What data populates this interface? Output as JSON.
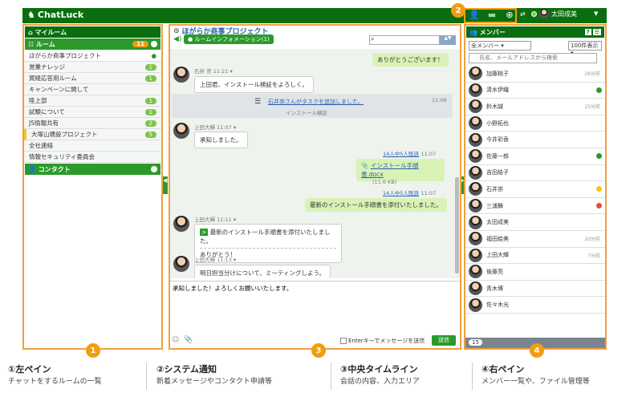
{
  "app": {
    "name": "ChatLuck",
    "user": "太田成美"
  },
  "left": {
    "my_room": "マイルーム",
    "rooms_header": "ルーム",
    "rooms_badge": "11",
    "rooms": [
      {
        "name": "ほがらか商事プロジェクト",
        "badge": ""
      },
      {
        "name": "営業ナレッジ",
        "badge": "1"
      },
      {
        "name": "貿経応答用ルーム",
        "badge": "1"
      },
      {
        "name": "キャンペーンに関して",
        "badge": ""
      },
      {
        "name": "陸上部",
        "badge": "1"
      },
      {
        "name": "試験について",
        "badge": "1"
      },
      {
        "name": "JS情報共有",
        "badge": "2"
      },
      {
        "name": "大塚山建設プロジェクト",
        "badge": "5"
      },
      {
        "name": "全社連絡",
        "badge": ""
      },
      {
        "name": "情報セキュリティ委員会",
        "badge": ""
      }
    ],
    "contacts": "コンタクト"
  },
  "center": {
    "room_title": "ほがらか商事プロジェクト",
    "room_info": "ルームインフォメーション(1)",
    "search_placeholder": "",
    "messages": {
      "m1": "ありがとうございます！",
      "m2_name": "石井 崇",
      "m2_time": "11:21",
      "m2_text": "上田君、インストール検証をよろしく。",
      "task_text": "石井崇さんがタスクを追加しました。",
      "task_sub": "インストール検証",
      "task_time": "11:06",
      "m3_name": "上田大輝",
      "m3_time": "11:07",
      "m3_text": "承知しました。",
      "read1": "14人中5人既読",
      "read1_time": "11:07",
      "file_name": "インストール手順書.docx",
      "file_size": "(11.6 KB)",
      "read2": "14人中5人既読",
      "read2_time": "11:07",
      "m4_text": "最新のインストール手順書を添付いたしました。",
      "m5_name": "上田大輝",
      "m5_time": "11:11",
      "m5_quote": "最新のインストール手順書を添付いたしました。",
      "m5_text": "ありがとう！",
      "m6_name": "上田大輝",
      "m6_time": "11:13",
      "m6_text": "明日担当分けについて、ミーティングしよう。"
    },
    "input_text": "承知しました！よろしくお願いいたします。",
    "enter_label": "Enterキーでメッセージを送信",
    "send_label": "送信"
  },
  "right": {
    "header": "メンバー",
    "filter": "全メンバー",
    "per_page": "100件表示",
    "search_placeholder": "氏名、メールアドレスから検索",
    "members": [
      {
        "name": "加藤桃子",
        "meta": "26分前",
        "status": ""
      },
      {
        "name": "清水伊織",
        "meta": "",
        "status": "green"
      },
      {
        "name": "鈴木誠",
        "meta": "25分前",
        "status": ""
      },
      {
        "name": "小野拓也",
        "meta": "",
        "status": ""
      },
      {
        "name": "今井彩香",
        "meta": "",
        "status": ""
      },
      {
        "name": "佐藤一郎",
        "meta": "",
        "status": "green"
      },
      {
        "name": "吉田結子",
        "meta": "",
        "status": ""
      },
      {
        "name": "石井崇",
        "meta": "",
        "status": "yellow"
      },
      {
        "name": "三浦舞",
        "meta": "",
        "status": "red"
      },
      {
        "name": "太田成美",
        "meta": "",
        "status": ""
      },
      {
        "name": "福田絵美",
        "meta": "20分前",
        "status": ""
      },
      {
        "name": "上田大輝",
        "meta": "7分前",
        "status": ""
      },
      {
        "name": "後藤亮",
        "meta": "",
        "status": ""
      },
      {
        "name": "青木博",
        "meta": "",
        "status": ""
      },
      {
        "name": "佐々木光",
        "meta": "",
        "status": ""
      }
    ],
    "count": "15"
  },
  "callouts": {
    "n1": "1",
    "n2": "2",
    "n3": "3",
    "n4": "4"
  },
  "legend": [
    {
      "title": "①左ペイン",
      "sub": "チャットをするルームの一覧"
    },
    {
      "title": "②システム通知",
      "sub": "新着メッセージやコンタクト申請等"
    },
    {
      "title": "③中央タイムライン",
      "sub": "会話の内容、入力エリア"
    },
    {
      "title": "④右ペイン",
      "sub": "メンバー一覧や、ファイル管理等"
    }
  ],
  "colors": {
    "brand": "#0a6e0e",
    "accent": "#2b9a2b",
    "callout": "#f39c12"
  }
}
